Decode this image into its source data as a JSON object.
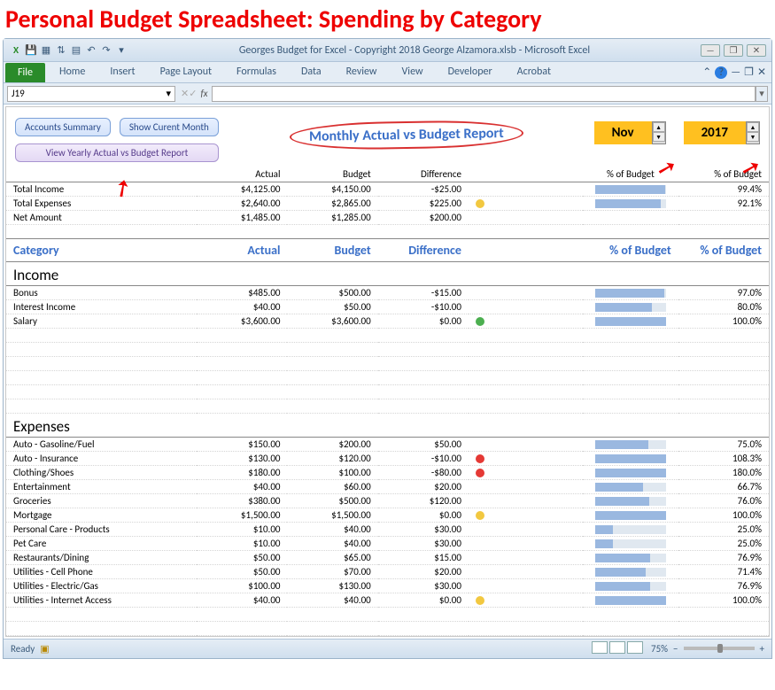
{
  "overlay_title": "Personal Budget Spreadsheet: Spending by Category",
  "window_title": "Georges Budget for Excel - Copyright 2018 George Alzamora.xlsb  -  Microsoft Excel",
  "ribbon": {
    "file": "File",
    "tabs": [
      "Home",
      "Insert",
      "Page Layout",
      "Formulas",
      "Data",
      "Review",
      "View",
      "Developer",
      "Acrobat"
    ]
  },
  "namebox": "J19",
  "buttons": {
    "accounts_summary": "Accounts Summary",
    "show_current_month": "Show Curent Month",
    "view_yearly": "View Yearly Actual vs Budget Report"
  },
  "report_title": "Monthly Actual vs Budget Report",
  "month": "Nov",
  "year": "2017",
  "summary_headers": {
    "actual": "Actual",
    "budget": "Budget",
    "difference": "Difference",
    "pct1": "% of Budget",
    "pct2": "% of Budget"
  },
  "summary": [
    {
      "name": "Total Income",
      "actual": "$4,125.00",
      "budget": "$4,150.00",
      "diff": "-$25.00",
      "dot": "",
      "pct": "99.4%",
      "fill": 99
    },
    {
      "name": "Total Expenses",
      "actual": "$2,640.00",
      "budget": "$2,865.00",
      "diff": "$225.00",
      "dot": "y",
      "pct": "92.1%",
      "fill": 92
    },
    {
      "name": "Net Amount",
      "actual": "$1,485.00",
      "budget": "$1,285.00",
      "diff": "$200.00",
      "dot": "",
      "pct": "",
      "fill": null
    }
  ],
  "cat_headers": {
    "category": "Category",
    "actual": "Actual",
    "budget": "Budget",
    "difference": "Difference",
    "pct1": "% of Budget",
    "pct2": "% of Budget"
  },
  "sections": [
    {
      "title": "Income",
      "rows": [
        {
          "name": "Bonus",
          "actual": "$485.00",
          "budget": "$500.00",
          "diff": "-$15.00",
          "dot": "",
          "pct": "97.0%",
          "fill": 97
        },
        {
          "name": "Interest Income",
          "actual": "$40.00",
          "budget": "$50.00",
          "diff": "-$10.00",
          "dot": "",
          "pct": "80.0%",
          "fill": 80
        },
        {
          "name": "Salary",
          "actual": "$3,600.00",
          "budget": "$3,600.00",
          "diff": "$0.00",
          "dot": "g",
          "pct": "100.0%",
          "fill": 100
        }
      ],
      "empty_after": 6
    },
    {
      "title": "Expenses",
      "rows": [
        {
          "name": "Auto - Gasoline/Fuel",
          "actual": "$150.00",
          "budget": "$200.00",
          "diff": "$50.00",
          "dot": "",
          "pct": "75.0%",
          "fill": 75
        },
        {
          "name": "Auto - Insurance",
          "actual": "$130.00",
          "budget": "$120.00",
          "diff": "-$10.00",
          "dot": "r",
          "pct": "108.3%",
          "fill": 100
        },
        {
          "name": "Clothing/Shoes",
          "actual": "$180.00",
          "budget": "$100.00",
          "diff": "-$80.00",
          "dot": "r",
          "pct": "180.0%",
          "fill": 100
        },
        {
          "name": "Entertainment",
          "actual": "$40.00",
          "budget": "$60.00",
          "diff": "$20.00",
          "dot": "",
          "pct": "66.7%",
          "fill": 67
        },
        {
          "name": "Groceries",
          "actual": "$380.00",
          "budget": "$500.00",
          "diff": "$120.00",
          "dot": "",
          "pct": "76.0%",
          "fill": 76
        },
        {
          "name": "Mortgage",
          "actual": "$1,500.00",
          "budget": "$1,500.00",
          "diff": "$0.00",
          "dot": "y",
          "pct": "100.0%",
          "fill": 100
        },
        {
          "name": "Personal Care - Products",
          "actual": "$10.00",
          "budget": "$40.00",
          "diff": "$30.00",
          "dot": "",
          "pct": "25.0%",
          "fill": 25
        },
        {
          "name": "Pet Care",
          "actual": "$10.00",
          "budget": "$40.00",
          "diff": "$30.00",
          "dot": "",
          "pct": "25.0%",
          "fill": 25
        },
        {
          "name": "Restaurants/Dining",
          "actual": "$50.00",
          "budget": "$65.00",
          "diff": "$15.00",
          "dot": "",
          "pct": "76.9%",
          "fill": 77
        },
        {
          "name": "Utilities - Cell Phone",
          "actual": "$50.00",
          "budget": "$70.00",
          "diff": "$20.00",
          "dot": "",
          "pct": "71.4%",
          "fill": 71
        },
        {
          "name": "Utilities - Electric/Gas",
          "actual": "$100.00",
          "budget": "$130.00",
          "diff": "$30.00",
          "dot": "",
          "pct": "76.9%",
          "fill": 77
        },
        {
          "name": "Utilities - Internet Access",
          "actual": "$40.00",
          "budget": "$40.00",
          "diff": "$0.00",
          "dot": "y",
          "pct": "100.0%",
          "fill": 100
        }
      ],
      "empty_after": 2
    }
  ],
  "status": {
    "ready": "Ready",
    "zoom": "75%"
  }
}
